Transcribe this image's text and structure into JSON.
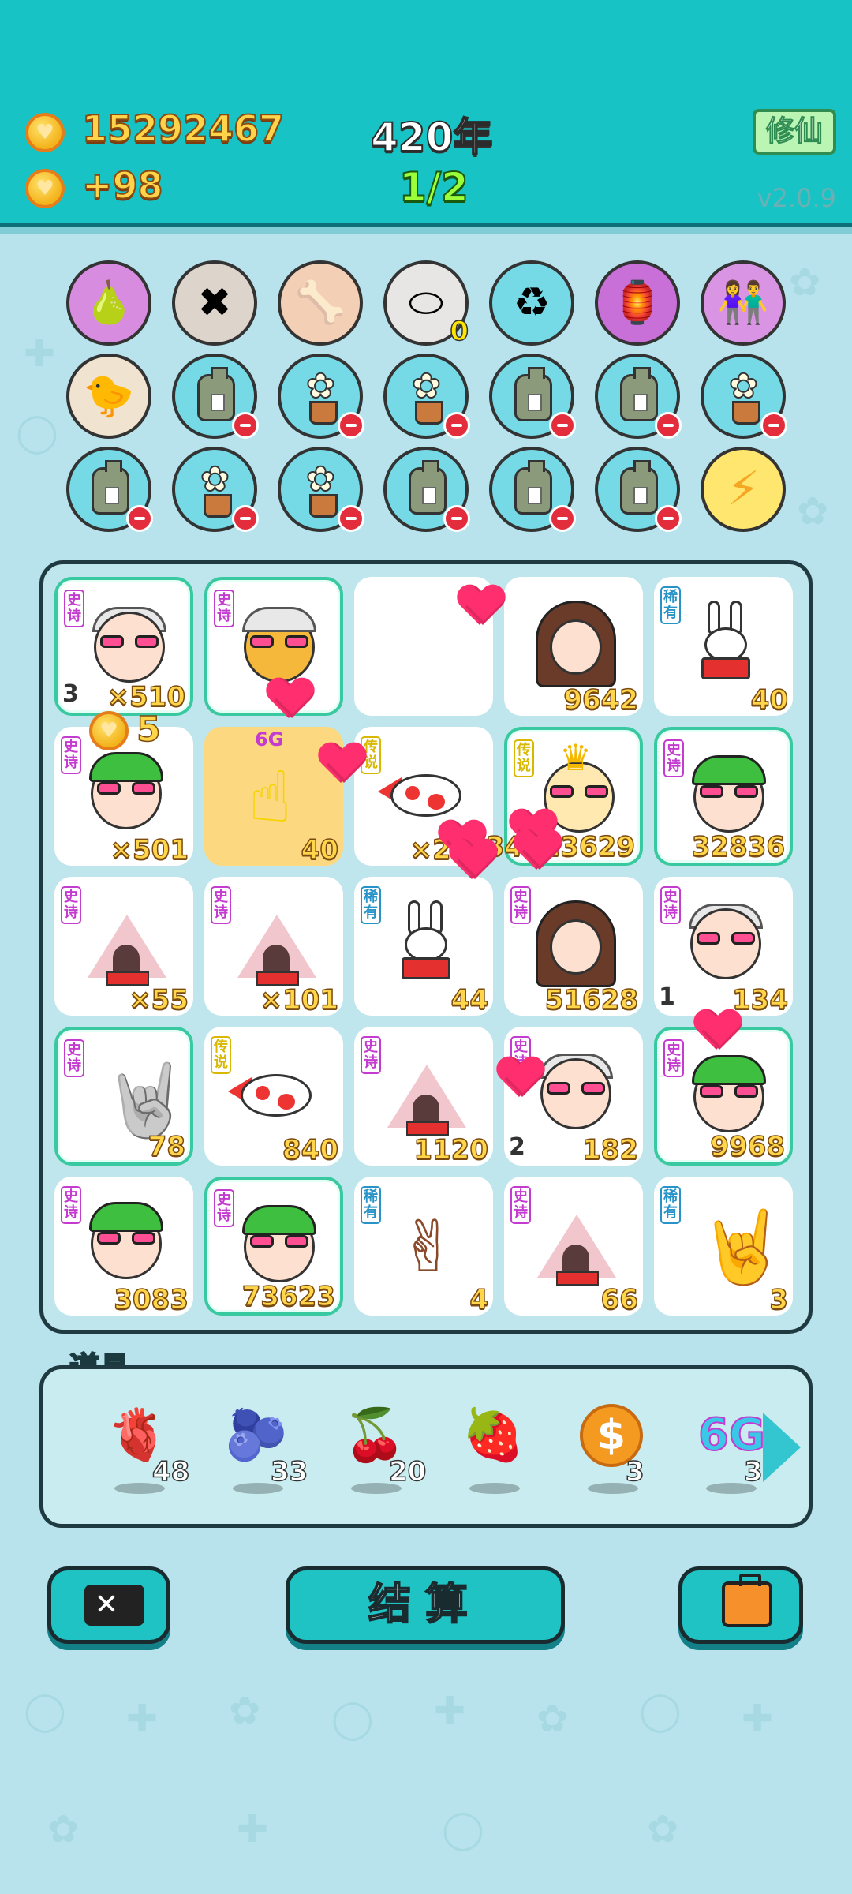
{
  "header": {
    "coins": "15292467",
    "income": "+98",
    "year": "420年",
    "progress": "1/2",
    "cultivate_button": "修仙",
    "version": "v2.0.9"
  },
  "tools": [
    {
      "icon": "pomelo-icon",
      "color": "#d88ce0"
    },
    {
      "icon": "delete-tag-icon",
      "color": "#ddd4cc"
    },
    {
      "icon": "dog-bowl-icon",
      "color": "#f2cfb5"
    },
    {
      "icon": "egg-tray-icon",
      "color": "#e8e6e4",
      "count": "0"
    },
    {
      "icon": "recycle-bag-icon",
      "color": "#75d9e6"
    },
    {
      "icon": "lantern-icon",
      "color": "#c96fd8"
    },
    {
      "icon": "couple-icon",
      "color": "#d995e4"
    },
    {
      "icon": "chick-egg-icon",
      "color": "#f0e3d0"
    },
    {
      "icon": "sack-icon",
      "color": "#75d9e6"
    },
    {
      "icon": "flower-pot-icon",
      "color": "#75d9e6"
    },
    {
      "icon": "flower-pot-icon",
      "color": "#75d9e6"
    },
    {
      "icon": "sack-icon",
      "color": "#75d9e6"
    },
    {
      "icon": "sack-icon",
      "color": "#75d9e6"
    },
    {
      "icon": "flower-pot-icon",
      "color": "#75d9e6"
    },
    {
      "icon": "sack-icon",
      "color": "#75d9e6"
    },
    {
      "icon": "flower-pot-icon",
      "color": "#75d9e6"
    },
    {
      "icon": "flower-pot-icon",
      "color": "#75d9e6"
    },
    {
      "icon": "sack-icon",
      "color": "#75d9e6"
    },
    {
      "icon": "sack-icon",
      "color": "#75d9e6"
    },
    {
      "icon": "sack-icon",
      "color": "#75d9e6"
    },
    {
      "icon": "lightning-icon",
      "color": "#ffe66e"
    }
  ],
  "board": {
    "cells": [
      {
        "tag": "史诗",
        "tag_type": "epic",
        "art": "old-man-face",
        "count": "×510",
        "level": "3",
        "selected": true
      },
      {
        "tag": "史诗",
        "tag_type": "epic",
        "art": "cool-chick",
        "count": "",
        "selected": true
      },
      {
        "tag": "",
        "art": "empty",
        "count": ""
      },
      {
        "tag": "",
        "art": "girl-face",
        "count": "9642"
      },
      {
        "tag": "稀有",
        "tag_type": "rare",
        "art": "rabbit",
        "count": "40"
      },
      {
        "tag": "史诗",
        "tag_type": "epic",
        "art": "green-hat-face",
        "count": "×501",
        "bonus": "5"
      },
      {
        "tag": "",
        "art": "pointing-hand",
        "count": "40",
        "highlight": true,
        "badge": "6G"
      },
      {
        "tag": "传说",
        "tag_type": "legend",
        "art": "koi-fish",
        "count": "×251"
      },
      {
        "tag": "传说",
        "tag_type": "legend",
        "art": "king-face",
        "count": "34823629",
        "selected": true
      },
      {
        "tag": "史诗",
        "tag_type": "epic",
        "art": "green-hat-face",
        "count": "32836",
        "selected": true
      },
      {
        "tag": "史诗",
        "tag_type": "epic",
        "art": "tent",
        "count": "×55"
      },
      {
        "tag": "史诗",
        "tag_type": "epic",
        "art": "tent",
        "count": "×101"
      },
      {
        "tag": "稀有",
        "tag_type": "rare",
        "art": "rabbit",
        "count": "44"
      },
      {
        "tag": "史诗",
        "tag_type": "epic",
        "art": "girl-face",
        "count": "51628"
      },
      {
        "tag": "史诗",
        "tag_type": "epic",
        "art": "old-man-face",
        "count": "134",
        "level": "1"
      },
      {
        "tag": "史诗",
        "tag_type": "epic",
        "art": "rock-hand",
        "count": "78",
        "selected": true
      },
      {
        "tag": "传说",
        "tag_type": "legend",
        "art": "koi-fish",
        "count": "840"
      },
      {
        "tag": "史诗",
        "tag_type": "epic",
        "art": "tent",
        "count": "1120"
      },
      {
        "tag": "史诗",
        "tag_type": "epic",
        "art": "old-man-face",
        "count": "182",
        "level": "2"
      },
      {
        "tag": "史诗",
        "tag_type": "epic",
        "art": "green-hat-face",
        "count": "9968",
        "selected": true
      },
      {
        "tag": "史诗",
        "tag_type": "epic",
        "art": "green-hat-face",
        "count": "3083"
      },
      {
        "tag": "史诗",
        "tag_type": "epic",
        "art": "green-hat-face",
        "count": "73623",
        "selected": true
      },
      {
        "tag": "稀有",
        "tag_type": "rare",
        "art": "peace-hand",
        "count": "4"
      },
      {
        "tag": "史诗",
        "tag_type": "epic",
        "art": "tent",
        "count": "66"
      },
      {
        "tag": "稀有",
        "tag_type": "rare",
        "art": "rock-hand-brown",
        "count": "3"
      }
    ]
  },
  "props": {
    "label": "道具",
    "items": [
      {
        "icon": "liver-icon",
        "glyph": "🫀",
        "count": "48"
      },
      {
        "icon": "blueberry-icon",
        "glyph": "🫐",
        "count": "33"
      },
      {
        "icon": "lychee-icon",
        "glyph": "🍒",
        "count": "20"
      },
      {
        "icon": "strawberry-icon",
        "glyph": "🍓",
        "count": ""
      },
      {
        "icon": "dollar-coin-icon",
        "glyph": "$",
        "count": "3"
      },
      {
        "icon": "6g-icon",
        "glyph": "6G",
        "count": "3"
      }
    ]
  },
  "actions": {
    "settle_label": "结算"
  }
}
